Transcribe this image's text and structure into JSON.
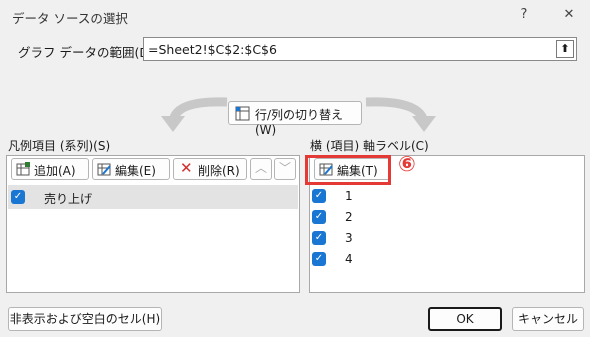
{
  "dialog": {
    "title": "データ ソースの選択",
    "help_label": "?",
    "close_label": "✕"
  },
  "range": {
    "label": "グラフ データの範囲(D):",
    "value": "=Sheet2!$C$2:$C$6"
  },
  "switch_button": {
    "label": "行/列の切り替え(W)"
  },
  "series": {
    "section_label": "凡例項目 (系列)(S)",
    "add_label": "追加(A)",
    "edit_label": "編集(E)",
    "delete_label": "削除(R)",
    "items": [
      {
        "label": "売り上げ",
        "checked": true
      }
    ]
  },
  "categories": {
    "section_label": "横 (項目) 軸ラベル(C)",
    "edit_label": "編集(T)",
    "items": [
      {
        "label": "1",
        "checked": true
      },
      {
        "label": "2",
        "checked": true
      },
      {
        "label": "3",
        "checked": true
      },
      {
        "label": "4",
        "checked": true
      }
    ]
  },
  "annotation": {
    "step": "⑥",
    "color": "#e53935"
  },
  "footer": {
    "hidden_cells_label": "非表示および空白のセル(H)",
    "ok_label": "OK",
    "cancel_label": "キャンセル"
  },
  "colors": {
    "check": "#1976d2",
    "highlight": "#e53935"
  }
}
